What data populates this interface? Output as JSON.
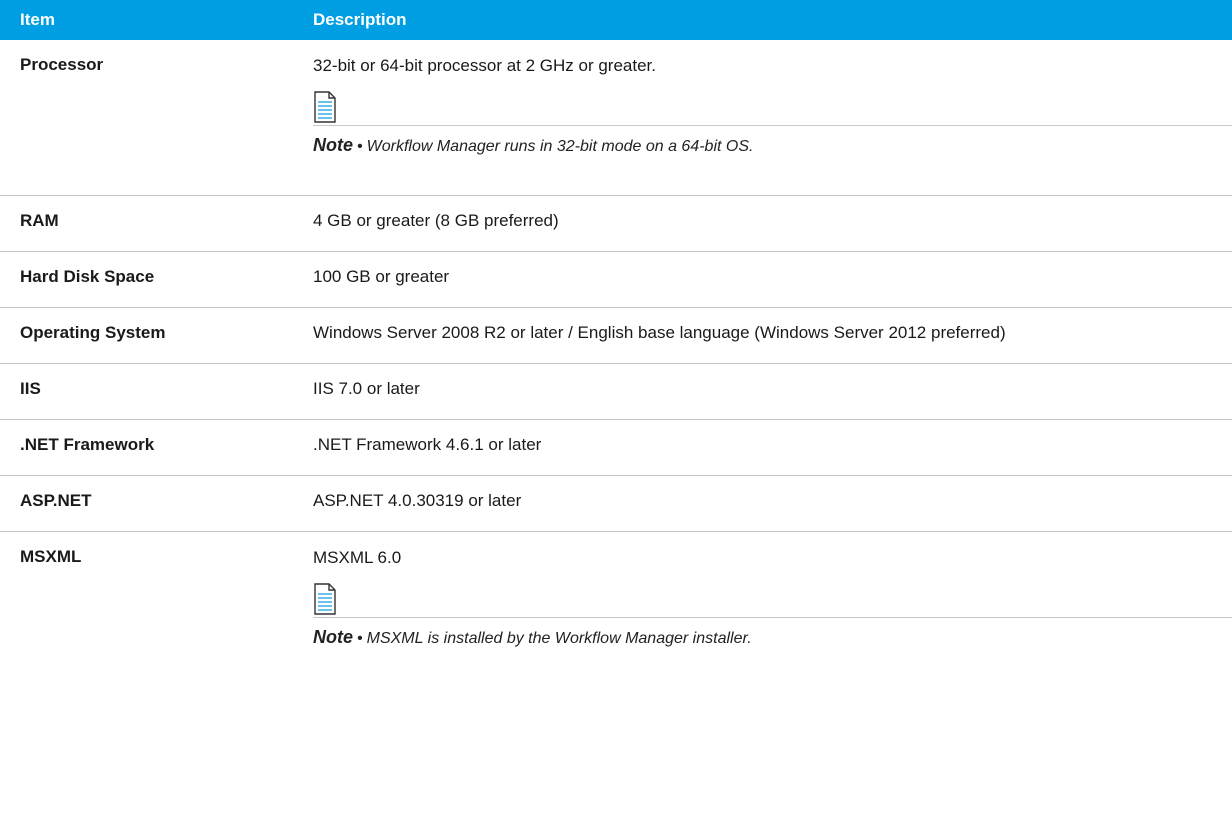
{
  "header": {
    "item": "Item",
    "description": "Description"
  },
  "rows": [
    {
      "item": "Processor",
      "description": "32-bit or 64-bit processor at 2 GHz or greater.",
      "note": {
        "label": "Note",
        "bullet": "•",
        "text": "Workflow Manager runs in 32-bit mode on a 64-bit OS."
      }
    },
    {
      "item": "RAM",
      "description": "4 GB or greater (8 GB preferred)"
    },
    {
      "item": "Hard Disk Space",
      "description": "100 GB or greater"
    },
    {
      "item": "Operating System",
      "description": "Windows Server 2008 R2 or later / English base language (Windows Server 2012 preferred)"
    },
    {
      "item": "IIS",
      "description": "IIS 7.0 or later"
    },
    {
      "item": ".NET Framework",
      "description": ".NET Framework 4.6.1 or later"
    },
    {
      "item": "ASP.NET",
      "description": "ASP.NET 4.0.30319 or later"
    },
    {
      "item": "MSXML",
      "description": "MSXML 6.0",
      "note": {
        "label": "Note",
        "bullet": "•",
        "text": "MSXML is installed by the Workflow Manager installer."
      }
    }
  ],
  "icons": {
    "note": "note-document-icon"
  },
  "colors": {
    "header_bg": "#009fe3",
    "header_text": "#ffffff",
    "icon_stroke": "#2aa9e0"
  }
}
